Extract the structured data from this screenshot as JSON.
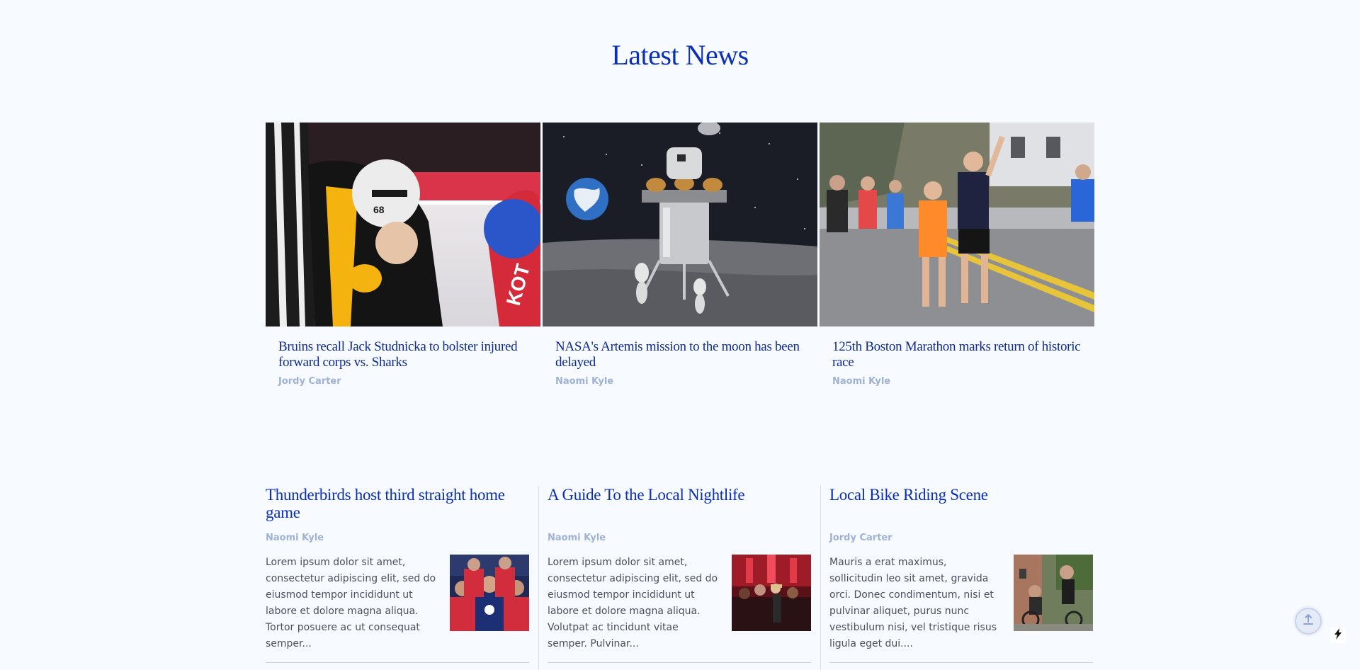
{
  "section": {
    "title": "Latest News"
  },
  "featured": [
    {
      "headline": "Bruins recall Jack Studnicka to bolster injured forward corps vs. Sharks",
      "author": "Jordy Carter",
      "image": "hockey-faceoff-photo"
    },
    {
      "headline": "NASA's Artemis mission to the moon has been delayed",
      "author": "Naomi Kyle",
      "image": "lunar-lander-render"
    },
    {
      "headline": "125th Boston Marathon marks return of historic race",
      "author": "Naomi Kyle",
      "image": "marathon-runners-photo"
    }
  ],
  "articles": [
    {
      "headline": "Thunderbirds host third straight home game",
      "author": "Naomi Kyle",
      "excerpt": "Lorem ipsum dolor sit amet, consectetur adipiscing elit, sed do eiusmod tempor incididunt ut labore et dolore magna aliqua. Tortor posuere ac ut consequat semper...",
      "image": "hockey-team-photo"
    },
    {
      "headline": "A Guide To the Local Nightlife",
      "author": "Naomi Kyle",
      "excerpt": "Lorem ipsum dolor sit amet, consectetur adipiscing elit, sed do eiusmod tempor incididunt ut labore et dolore magna aliqua. Volutpat ac tincidunt vitae semper. Pulvinar...",
      "image": "nightclub-crowd-photo"
    },
    {
      "headline": "Local Bike Riding Scene",
      "author": "Jordy Carter",
      "excerpt": "Mauris a erat maximus, sollicitudin leo sit amet, gravida orci. Donec condimentum, nisi et pulvinar aliquet, purus nunc vestibulum nisi, vel tristique risus ligula eget dui....",
      "image": "bike-riders-photo"
    }
  ],
  "controls": {
    "scroll_top_icon": "arrow-up-icon",
    "badge_icon": "lightning-bolt-icon"
  },
  "colors": {
    "accent": "#0a2fb8",
    "headline": "#0d2a8e",
    "author": "#9fb2d6",
    "background": "#f7faff"
  }
}
